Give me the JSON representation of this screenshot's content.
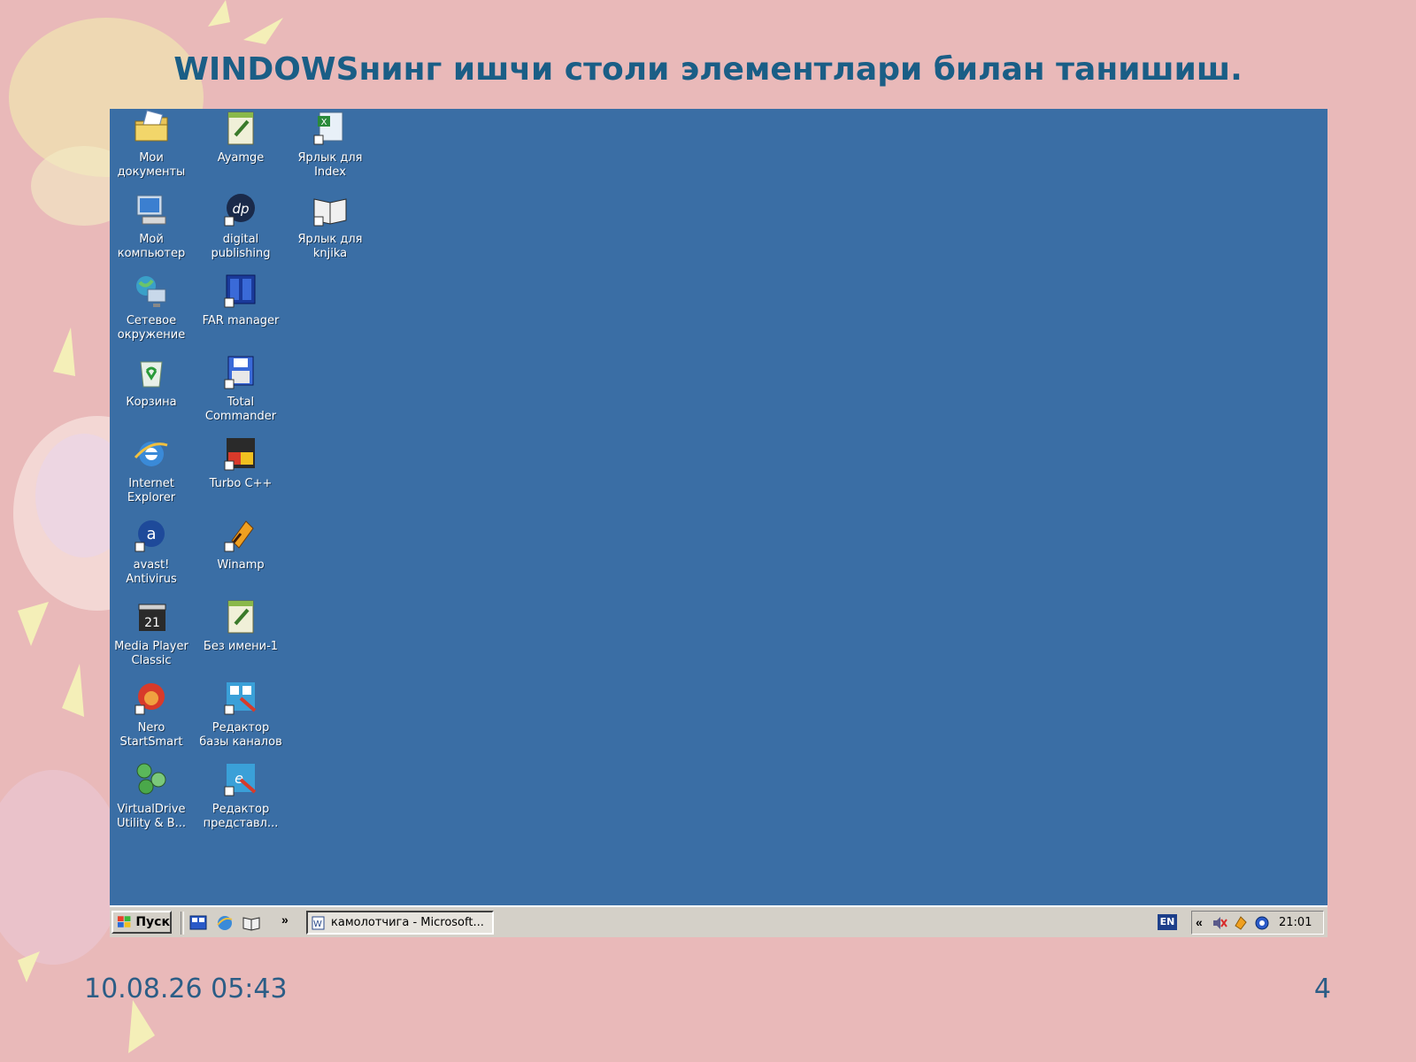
{
  "slide": {
    "title": "WINDOWSнинг ишчи столи элементлари билан танишиш.",
    "date": "10.08.26 05:43",
    "page_number": "4"
  },
  "desktop": {
    "background_color": "#3a6ea5",
    "icons": [
      {
        "label": "Мои\nдокументы",
        "icon": "my-documents-icon"
      },
      {
        "label": "Мой\nкомпьютер",
        "icon": "my-computer-icon"
      },
      {
        "label": "Сетевое\nокружение",
        "icon": "network-icon"
      },
      {
        "label": "Корзина",
        "icon": "recycle-bin-icon"
      },
      {
        "label": "Internet\nExplorer",
        "icon": "internet-explorer-icon"
      },
      {
        "label": "avast!\nAntivirus",
        "icon": "avast-icon"
      },
      {
        "label": "Media Player\nClassic",
        "icon": "media-player-icon"
      },
      {
        "label": "Nero\nStartSmart",
        "icon": "nero-icon"
      },
      {
        "label": "VirtualDrive\nUtility & B...",
        "icon": "virtualdrive-icon"
      },
      {
        "label": "Ayamge",
        "icon": "document-icon"
      },
      {
        "label": "digital\npublishing",
        "icon": "digital-publishing-icon"
      },
      {
        "label": "FAR manager",
        "icon": "far-manager-icon"
      },
      {
        "label": "Total\nCommander",
        "icon": "total-commander-icon"
      },
      {
        "label": "Turbo C++",
        "icon": "turbo-cpp-icon"
      },
      {
        "label": "Winamp",
        "icon": "winamp-icon"
      },
      {
        "label": "Без имени-1",
        "icon": "document-icon"
      },
      {
        "label": "Редактор\nбазы каналов",
        "icon": "channel-editor-icon"
      },
      {
        "label": "Редактор\nпредставл...",
        "icon": "presentation-editor-icon"
      },
      {
        "label": "Ярлык для\nIndex",
        "icon": "excel-shortcut-icon"
      },
      {
        "label": "Ярлык для\nknjika",
        "icon": "book-shortcut-icon"
      }
    ]
  },
  "taskbar": {
    "start_label": "Пуск",
    "quick_launch": [
      "show-desktop-icon",
      "ie-quick-icon",
      "book-quick-icon"
    ],
    "overflow": "»",
    "task_label": "камолотчига - Microsoft...",
    "language": "EN",
    "tray_arrow": "«",
    "tray_icons": [
      "volume-muted-icon",
      "power-icon",
      "network-tray-icon"
    ],
    "clock": "21:01"
  }
}
